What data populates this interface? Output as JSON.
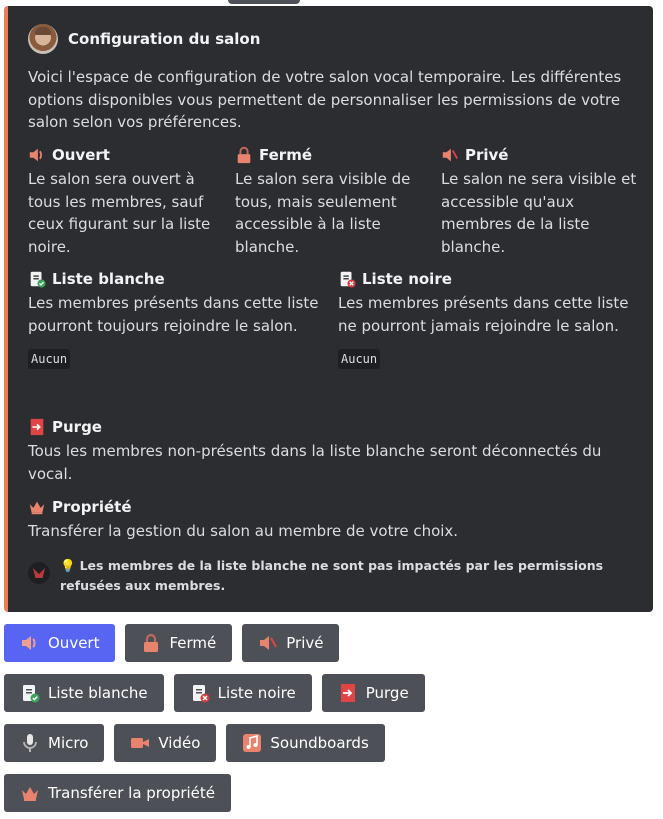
{
  "embed": {
    "accent_color": "#e67e59",
    "author": {
      "name": "Configuration du salon"
    },
    "description": "Voici l'espace de configuration de votre salon vocal temporaire. Les différentes options disponibles vous permettent de personnaliser les permissions de votre salon selon vos préférences.",
    "fields": {
      "ouvert": {
        "title": "Ouvert",
        "icon": "speaker-icon",
        "value": "Le salon sera ouvert à tous les membres, sauf ceux figurant sur la liste noire."
      },
      "ferme": {
        "title": "Fermé",
        "icon": "lock-icon",
        "value": "Le salon sera visible de tous, mais seulement accessible à la liste blanche."
      },
      "prive": {
        "title": "Privé",
        "icon": "speaker-muted-icon",
        "value": "Le salon ne sera visible et accessible qu'aux membres de la liste blanche."
      },
      "liste_blanche": {
        "title": "Liste blanche",
        "icon": "clipboard-check-icon",
        "value": "Les membres présents dans cette liste pourront toujours rejoindre le salon.",
        "members": "Aucun"
      },
      "liste_noire": {
        "title": "Liste noire",
        "icon": "clipboard-x-icon",
        "value": "Les membres présents dans cette liste ne pourront jamais rejoindre le salon.",
        "members": "Aucun"
      },
      "purge": {
        "title": "Purge",
        "icon": "exit-door-icon",
        "value": "Tous les membres non-présents dans la liste blanche seront déconnectés du vocal."
      },
      "propriete": {
        "title": "Propriété",
        "icon": "crown-icon",
        "value": "Transférer la gestion du salon au membre de votre choix."
      }
    },
    "footer": {
      "icon": "lightbulb-icon",
      "text": "Les membres de la liste blanche ne sont pas impactés par les permissions refusées aux membres."
    }
  },
  "buttons": {
    "ouvert": "Ouvert",
    "ferme": "Fermé",
    "prive": "Privé",
    "liste_blanche": "Liste blanche",
    "liste_noire": "Liste noire",
    "purge": "Purge",
    "micro": "Micro",
    "video": "Vidéo",
    "soundboards": "Soundboards",
    "transferer": "Transférer la propriété"
  },
  "colors": {
    "primary_button": "#5865f2",
    "secondary_button": "#4e5058",
    "embed_bg": "#2b2d31"
  }
}
